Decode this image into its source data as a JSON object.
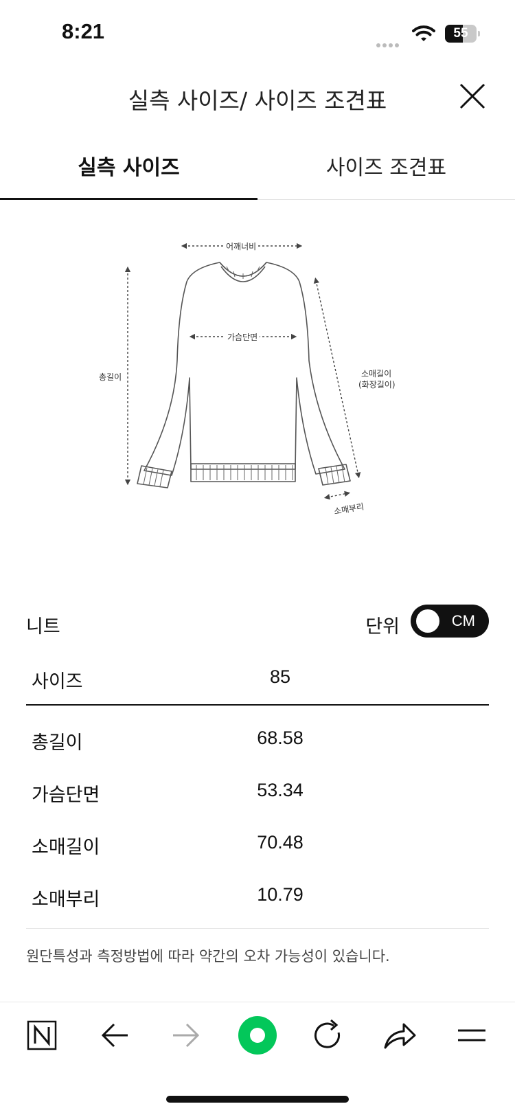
{
  "status": {
    "time": "8:21",
    "battery": "55"
  },
  "header": {
    "title": "실측 사이즈/ 사이즈 조견표"
  },
  "tabs": [
    {
      "label": "실측 사이즈",
      "active": true
    },
    {
      "label": "사이즈 조견표",
      "active": false
    }
  ],
  "diagram": {
    "shoulder": "어깨너비",
    "chest": "가슴단면",
    "length": "총길이",
    "sleeve": "소매길이",
    "sleeve_alt": "(화장길이)",
    "cuff": "소매부리"
  },
  "product": {
    "name": "니트",
    "unit_label": "단위",
    "unit_value": "CM"
  },
  "table": {
    "header": {
      "label": "사이즈",
      "value": "85"
    },
    "rows": [
      {
        "label": "총길이",
        "value": "68.58"
      },
      {
        "label": "가슴단면",
        "value": "53.34"
      },
      {
        "label": "소매길이",
        "value": "70.48"
      },
      {
        "label": "소매부리",
        "value": "10.79"
      }
    ]
  },
  "note": "원단특성과 측정방법에 따라 약간의 오차 가능성이 있습니다.",
  "colors": {
    "accent": "#111111",
    "naver_green": "#03c75a",
    "muted": "#aaaaaa"
  },
  "toolbar": [
    "naver-n-icon",
    "back-arrow-icon",
    "forward-arrow-icon",
    "green-dot-icon",
    "refresh-icon",
    "share-icon",
    "menu-icon"
  ]
}
